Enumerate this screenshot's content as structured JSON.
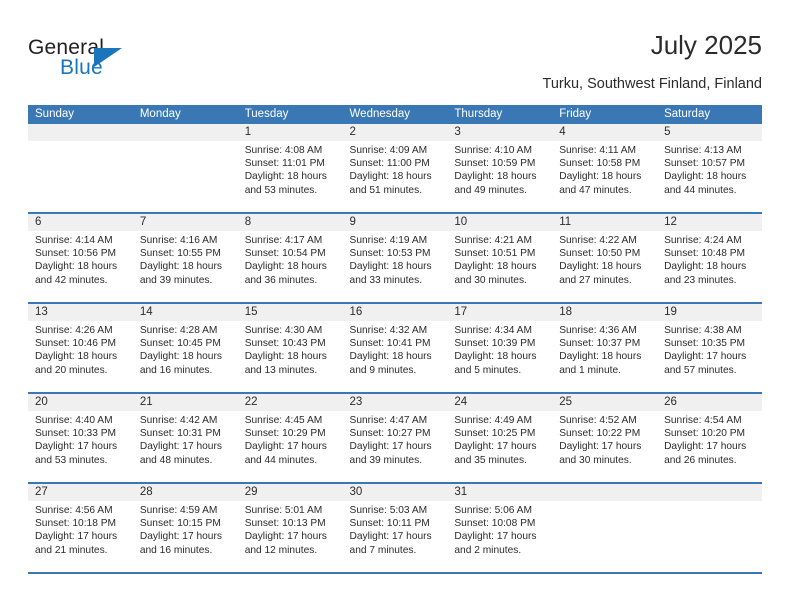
{
  "brand": {
    "name_top": "General",
    "name_bottom": "Blue",
    "accent_color": "#1b75bb"
  },
  "header": {
    "month_title": "July 2025",
    "location": "Turku, Southwest Finland, Finland"
  },
  "theme": {
    "header_row_bg": "#3a78b5",
    "day_head_bg": "#f0f0f0",
    "separator": "#3a78b5",
    "text": "#2b2b2b"
  },
  "calendar": {
    "weekday_headers": [
      "Sunday",
      "Monday",
      "Tuesday",
      "Wednesday",
      "Thursday",
      "Friday",
      "Saturday"
    ],
    "weeks": [
      [
        {
          "day": "",
          "sunrise": "",
          "sunset": "",
          "daylight_line1": "",
          "daylight_line2": ""
        },
        {
          "day": "",
          "sunrise": "",
          "sunset": "",
          "daylight_line1": "",
          "daylight_line2": ""
        },
        {
          "day": "1",
          "sunrise": "Sunrise: 4:08 AM",
          "sunset": "Sunset: 11:01 PM",
          "daylight_line1": "Daylight: 18 hours",
          "daylight_line2": "and 53 minutes."
        },
        {
          "day": "2",
          "sunrise": "Sunrise: 4:09 AM",
          "sunset": "Sunset: 11:00 PM",
          "daylight_line1": "Daylight: 18 hours",
          "daylight_line2": "and 51 minutes."
        },
        {
          "day": "3",
          "sunrise": "Sunrise: 4:10 AM",
          "sunset": "Sunset: 10:59 PM",
          "daylight_line1": "Daylight: 18 hours",
          "daylight_line2": "and 49 minutes."
        },
        {
          "day": "4",
          "sunrise": "Sunrise: 4:11 AM",
          "sunset": "Sunset: 10:58 PM",
          "daylight_line1": "Daylight: 18 hours",
          "daylight_line2": "and 47 minutes."
        },
        {
          "day": "5",
          "sunrise": "Sunrise: 4:13 AM",
          "sunset": "Sunset: 10:57 PM",
          "daylight_line1": "Daylight: 18 hours",
          "daylight_line2": "and 44 minutes."
        }
      ],
      [
        {
          "day": "6",
          "sunrise": "Sunrise: 4:14 AM",
          "sunset": "Sunset: 10:56 PM",
          "daylight_line1": "Daylight: 18 hours",
          "daylight_line2": "and 42 minutes."
        },
        {
          "day": "7",
          "sunrise": "Sunrise: 4:16 AM",
          "sunset": "Sunset: 10:55 PM",
          "daylight_line1": "Daylight: 18 hours",
          "daylight_line2": "and 39 minutes."
        },
        {
          "day": "8",
          "sunrise": "Sunrise: 4:17 AM",
          "sunset": "Sunset: 10:54 PM",
          "daylight_line1": "Daylight: 18 hours",
          "daylight_line2": "and 36 minutes."
        },
        {
          "day": "9",
          "sunrise": "Sunrise: 4:19 AM",
          "sunset": "Sunset: 10:53 PM",
          "daylight_line1": "Daylight: 18 hours",
          "daylight_line2": "and 33 minutes."
        },
        {
          "day": "10",
          "sunrise": "Sunrise: 4:21 AM",
          "sunset": "Sunset: 10:51 PM",
          "daylight_line1": "Daylight: 18 hours",
          "daylight_line2": "and 30 minutes."
        },
        {
          "day": "11",
          "sunrise": "Sunrise: 4:22 AM",
          "sunset": "Sunset: 10:50 PM",
          "daylight_line1": "Daylight: 18 hours",
          "daylight_line2": "and 27 minutes."
        },
        {
          "day": "12",
          "sunrise": "Sunrise: 4:24 AM",
          "sunset": "Sunset: 10:48 PM",
          "daylight_line1": "Daylight: 18 hours",
          "daylight_line2": "and 23 minutes."
        }
      ],
      [
        {
          "day": "13",
          "sunrise": "Sunrise: 4:26 AM",
          "sunset": "Sunset: 10:46 PM",
          "daylight_line1": "Daylight: 18 hours",
          "daylight_line2": "and 20 minutes."
        },
        {
          "day": "14",
          "sunrise": "Sunrise: 4:28 AM",
          "sunset": "Sunset: 10:45 PM",
          "daylight_line1": "Daylight: 18 hours",
          "daylight_line2": "and 16 minutes."
        },
        {
          "day": "15",
          "sunrise": "Sunrise: 4:30 AM",
          "sunset": "Sunset: 10:43 PM",
          "daylight_line1": "Daylight: 18 hours",
          "daylight_line2": "and 13 minutes."
        },
        {
          "day": "16",
          "sunrise": "Sunrise: 4:32 AM",
          "sunset": "Sunset: 10:41 PM",
          "daylight_line1": "Daylight: 18 hours",
          "daylight_line2": "and 9 minutes."
        },
        {
          "day": "17",
          "sunrise": "Sunrise: 4:34 AM",
          "sunset": "Sunset: 10:39 PM",
          "daylight_line1": "Daylight: 18 hours",
          "daylight_line2": "and 5 minutes."
        },
        {
          "day": "18",
          "sunrise": "Sunrise: 4:36 AM",
          "sunset": "Sunset: 10:37 PM",
          "daylight_line1": "Daylight: 18 hours",
          "daylight_line2": "and 1 minute."
        },
        {
          "day": "19",
          "sunrise": "Sunrise: 4:38 AM",
          "sunset": "Sunset: 10:35 PM",
          "daylight_line1": "Daylight: 17 hours",
          "daylight_line2": "and 57 minutes."
        }
      ],
      [
        {
          "day": "20",
          "sunrise": "Sunrise: 4:40 AM",
          "sunset": "Sunset: 10:33 PM",
          "daylight_line1": "Daylight: 17 hours",
          "daylight_line2": "and 53 minutes."
        },
        {
          "day": "21",
          "sunrise": "Sunrise: 4:42 AM",
          "sunset": "Sunset: 10:31 PM",
          "daylight_line1": "Daylight: 17 hours",
          "daylight_line2": "and 48 minutes."
        },
        {
          "day": "22",
          "sunrise": "Sunrise: 4:45 AM",
          "sunset": "Sunset: 10:29 PM",
          "daylight_line1": "Daylight: 17 hours",
          "daylight_line2": "and 44 minutes."
        },
        {
          "day": "23",
          "sunrise": "Sunrise: 4:47 AM",
          "sunset": "Sunset: 10:27 PM",
          "daylight_line1": "Daylight: 17 hours",
          "daylight_line2": "and 39 minutes."
        },
        {
          "day": "24",
          "sunrise": "Sunrise: 4:49 AM",
          "sunset": "Sunset: 10:25 PM",
          "daylight_line1": "Daylight: 17 hours",
          "daylight_line2": "and 35 minutes."
        },
        {
          "day": "25",
          "sunrise": "Sunrise: 4:52 AM",
          "sunset": "Sunset: 10:22 PM",
          "daylight_line1": "Daylight: 17 hours",
          "daylight_line2": "and 30 minutes."
        },
        {
          "day": "26",
          "sunrise": "Sunrise: 4:54 AM",
          "sunset": "Sunset: 10:20 PM",
          "daylight_line1": "Daylight: 17 hours",
          "daylight_line2": "and 26 minutes."
        }
      ],
      [
        {
          "day": "27",
          "sunrise": "Sunrise: 4:56 AM",
          "sunset": "Sunset: 10:18 PM",
          "daylight_line1": "Daylight: 17 hours",
          "daylight_line2": "and 21 minutes."
        },
        {
          "day": "28",
          "sunrise": "Sunrise: 4:59 AM",
          "sunset": "Sunset: 10:15 PM",
          "daylight_line1": "Daylight: 17 hours",
          "daylight_line2": "and 16 minutes."
        },
        {
          "day": "29",
          "sunrise": "Sunrise: 5:01 AM",
          "sunset": "Sunset: 10:13 PM",
          "daylight_line1": "Daylight: 17 hours",
          "daylight_line2": "and 12 minutes."
        },
        {
          "day": "30",
          "sunrise": "Sunrise: 5:03 AM",
          "sunset": "Sunset: 10:11 PM",
          "daylight_line1": "Daylight: 17 hours",
          "daylight_line2": "and 7 minutes."
        },
        {
          "day": "31",
          "sunrise": "Sunrise: 5:06 AM",
          "sunset": "Sunset: 10:08 PM",
          "daylight_line1": "Daylight: 17 hours",
          "daylight_line2": "and 2 minutes."
        },
        {
          "day": "",
          "sunrise": "",
          "sunset": "",
          "daylight_line1": "",
          "daylight_line2": ""
        },
        {
          "day": "",
          "sunrise": "",
          "sunset": "",
          "daylight_line1": "",
          "daylight_line2": ""
        }
      ]
    ]
  }
}
